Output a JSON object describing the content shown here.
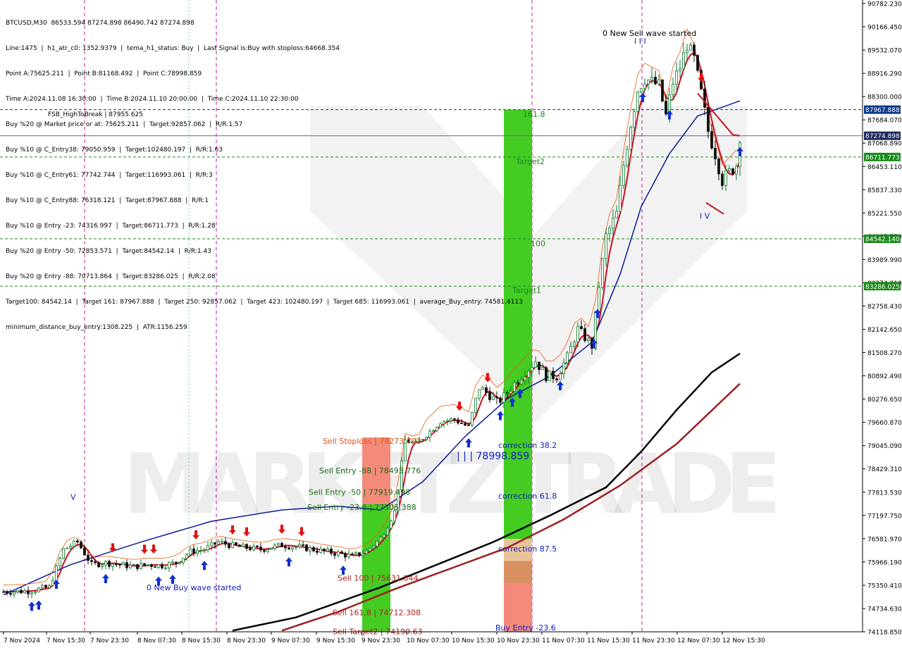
{
  "symbol_line": "BTCUSD,M30  86533.594 87274.898 86490.742 87274.898",
  "info_lines": [
    "Line:1475  |  h1_atr_c0: 1352.9379  |  tema_h1_status: Buy  |  Last Signal is:Buy with stoploss:64668.354",
    "Point A:75625.211  |  Point B:81168.492  |  Point C:78998.859",
    "Time A:2024.11.08 16:30:00  |  Time B:2024.11.10 20:00:00  |  Time C:2024.11.10 22:30:00",
    "Buy %20 @ Market price or at: 75625.211  |  Target:92857.062  |  R/R:1.57",
    "Buy %10 @ C_Entry38: 79050.959  |  Target:102480.197  |  R/R:1.63",
    "Buy %10 @ C_Entry61: 77742.744  |  Target:116993.061  |  R/R:3",
    "Buy %10 @ C_Entry88: 76318.121  |  Target:87967.888  |  R/R:1",
    "Buy %10 @ Entry -23: 74316.997  |  Target:86711.773  |  R/R:1.28",
    "Buy %20 @ Entry -50: 72853.571  |  Target:84542.14  |  R/R:1.43",
    "Buy %20 @ Entry -88: 70713.864  |  Target:83286.025  |  R/R:2.08",
    "Target100: 84542.14  |  Target 161: 87967.888  |  Target 250: 92857.062  |  Target 423: 102480.197  |  Target 685: 116993.061  |  average_Buy_entry: 74581.4113",
    "minimum_distance_buy_entry:1308.225  |  ATR:1156.259"
  ],
  "watermark": "MARKETZITRADE",
  "colors": {
    "bull_candle": "#0a7a28",
    "bear_candle": "#101010",
    "ma_fast": "#cc1020",
    "ma_mid": "#0a1a9a",
    "ma_slow_black": "#000000",
    "ma_slow_brown": "#9a2020",
    "level_green": "#1a8a1a",
    "current_price_bg": "#1a2a5a",
    "blue_level_bg": "#0a3a8a",
    "buy_zone_green": "#44cc22",
    "sell_zone_red": "#f48a7a",
    "buy_arrow": "#1030d0",
    "sell_arrow": "#e01010"
  },
  "chart_data": {
    "type": "candlestick",
    "symbol": "BTCUSD",
    "timeframe": "M30",
    "ylim": [
      74118.85,
      90782.23
    ],
    "y_ticks": [
      "90782.230",
      "90166.450",
      "89532.070",
      "88916.290",
      "88300.000",
      "87684.070",
      "87068.890",
      "86453.110",
      "85837.330",
      "85221.550",
      "84605.770",
      "83989.990",
      "83374.210",
      "82758.430",
      "82142.650",
      "81508.270",
      "80892.490",
      "80276.650",
      "79660.870",
      "79045.090",
      "78429.310",
      "77813.530",
      "77197.750",
      "76581.970",
      "75966.190",
      "75350.410",
      "74734.630",
      "74118.850"
    ],
    "x_ticks": [
      "7 Nov 2024",
      "7 Nov 15:30",
      "7 Nov 23:30",
      "8 Nov 07:30",
      "8 Nov 15:30",
      "8 Nov 23:30",
      "9 Nov 07:30",
      "9 Nov 15:30",
      "9 Nov 23:30",
      "10 Nov 07:30",
      "10 Nov 15:30",
      "10 Nov 23:30",
      "11 Nov 07:30",
      "11 Nov 15:30",
      "11 Nov 23:30",
      "12 Nov 07:30",
      "12 Nov 15:30"
    ],
    "current_price": "87274.898",
    "horizontal_levels": [
      {
        "value": 87967.888,
        "label": "87967.888",
        "style": "blue"
      },
      {
        "value": 86711.773,
        "label": "86711.773",
        "style": "green"
      },
      {
        "value": 84542.14,
        "label": "84542.140",
        "style": "green"
      },
      {
        "value": 83286.025,
        "label": "83286.025",
        "style": "green"
      }
    ],
    "annotations": [
      {
        "text": "0 New Sell wave started",
        "value": 90000,
        "color": "#000000"
      },
      {
        "text": "0 New Buy wave started",
        "value": 75300,
        "color": "#1020c0"
      },
      {
        "text": "I V",
        "value": 85150,
        "color": "#1020c0"
      },
      {
        "text": "I I I",
        "value": 89790,
        "color": "#1020c0"
      },
      {
        "text": "V",
        "value": 77700,
        "color": "#1020c0"
      },
      {
        "text": "161.8",
        "value": 87850,
        "color": "#1a8a1a"
      },
      {
        "text": "Target2",
        "value": 86600,
        "color": "#1a8a1a"
      },
      {
        "text": "100",
        "value": 84420,
        "color": "#1a8a1a"
      },
      {
        "text": "Target1",
        "value": 83180,
        "color": "#1a8a1a"
      },
      {
        "text": "correction 38.2",
        "value": 79070,
        "color": "#1020c0"
      },
      {
        "text": "| | | 78998.859",
        "value": 78770,
        "color": "#1020c0"
      },
      {
        "text": "correction 61.8",
        "value": 77720,
        "color": "#1020c0"
      },
      {
        "text": "correction 87.5",
        "value": 76320,
        "color": "#1020c0"
      },
      {
        "text": "Buy Entry -23.6",
        "value": 74230,
        "color": "#1020c0"
      },
      {
        "text": "Sell Stoploss | 79273.792",
        "value": 79180,
        "color": "#e05010"
      },
      {
        "text": "Sell Entry -88 | 78493.776",
        "value": 78400,
        "color": "#1a6a1a"
      },
      {
        "text": "Sell Entry -50 | 77919.498",
        "value": 77830,
        "color": "#1a6a1a"
      },
      {
        "text": "Sell Entry -23.6 | 77505.388",
        "value": 77430,
        "color": "#1a6a1a"
      },
      {
        "text": "Sell 100 | 75631.844",
        "value": 75550,
        "color": "#b02020"
      },
      {
        "text": "Sell 161.8 | 74712.308",
        "value": 74630,
        "color": "#b02020"
      },
      {
        "text": "Sell Target2 | 74199.63",
        "value": 74130,
        "color": "#b02020"
      },
      {
        "text": "FSB_HighToBreak | 87955.625",
        "value": 87870,
        "color": "#000000"
      }
    ],
    "zones": [
      {
        "name": "sell-zone",
        "from": 74118.85,
        "to": 79273.792
      },
      {
        "name": "buy-zone",
        "from": 74118.85,
        "to": 87967.888
      }
    ]
  }
}
